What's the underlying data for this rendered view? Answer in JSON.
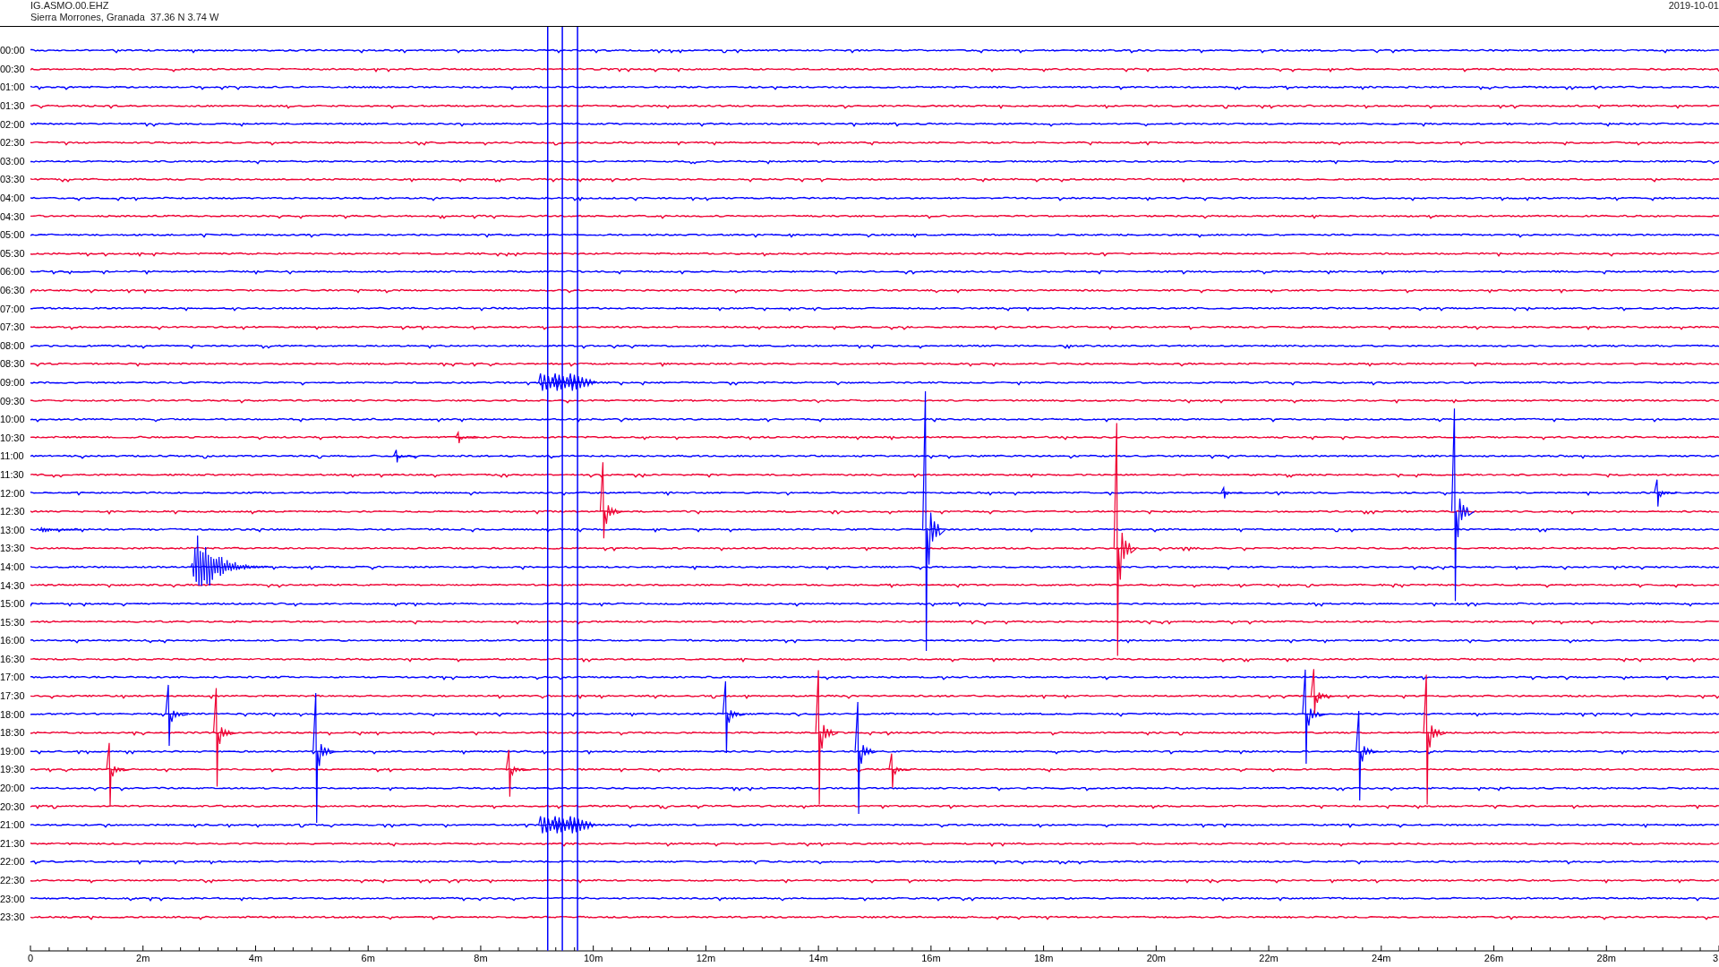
{
  "header": {
    "station": "IG.ASMO.00.EHZ",
    "location": "Sierra Morrones, Granada  37.36 N 3.74 W",
    "date": "2019-10-01"
  },
  "traces": [
    {
      "time": "00:00",
      "color": "#0000ff"
    },
    {
      "time": "00:30",
      "color": "#ee0033"
    },
    {
      "time": "01:00",
      "color": "#0000ff"
    },
    {
      "time": "01:30",
      "color": "#ee0033"
    },
    {
      "time": "02:00",
      "color": "#0000ff"
    },
    {
      "time": "02:30",
      "color": "#ee0033"
    },
    {
      "time": "03:00",
      "color": "#0000ff"
    },
    {
      "time": "03:30",
      "color": "#ee0033"
    },
    {
      "time": "04:00",
      "color": "#0000ff"
    },
    {
      "time": "04:30",
      "color": "#ee0033"
    },
    {
      "time": "05:00",
      "color": "#0000ff"
    },
    {
      "time": "05:30",
      "color": "#ee0033"
    },
    {
      "time": "06:00",
      "color": "#0000ff"
    },
    {
      "time": "06:30",
      "color": "#ee0033"
    },
    {
      "time": "07:00",
      "color": "#0000ff"
    },
    {
      "time": "07:30",
      "color": "#ee0033"
    },
    {
      "time": "08:00",
      "color": "#0000ff"
    },
    {
      "time": "08:30",
      "color": "#ee0033"
    },
    {
      "time": "09:00",
      "color": "#0000ff"
    },
    {
      "time": "09:30",
      "color": "#ee0033"
    },
    {
      "time": "10:00",
      "color": "#0000ff"
    },
    {
      "time": "10:30",
      "color": "#ee0033"
    },
    {
      "time": "11:00",
      "color": "#0000ff"
    },
    {
      "time": "11:30",
      "color": "#ee0033"
    },
    {
      "time": "12:00",
      "color": "#0000ff"
    },
    {
      "time": "12:30",
      "color": "#ee0033"
    },
    {
      "time": "13:00",
      "color": "#0000ff"
    },
    {
      "time": "13:30",
      "color": "#ee0033"
    },
    {
      "time": "14:00",
      "color": "#0000ff"
    },
    {
      "time": "14:30",
      "color": "#ee0033"
    },
    {
      "time": "15:00",
      "color": "#0000ff"
    },
    {
      "time": "15:30",
      "color": "#ee0033"
    },
    {
      "time": "16:00",
      "color": "#0000ff"
    },
    {
      "time": "16:30",
      "color": "#ee0033"
    },
    {
      "time": "17:00",
      "color": "#0000ff"
    },
    {
      "time": "17:30",
      "color": "#ee0033"
    },
    {
      "time": "18:00",
      "color": "#0000ff"
    },
    {
      "time": "18:30",
      "color": "#ee0033"
    },
    {
      "time": "19:00",
      "color": "#0000ff"
    },
    {
      "time": "19:30",
      "color": "#ee0033"
    },
    {
      "time": "20:00",
      "color": "#0000ff"
    },
    {
      "time": "20:30",
      "color": "#ee0033"
    },
    {
      "time": "21:00",
      "color": "#0000ff"
    },
    {
      "time": "21:30",
      "color": "#ee0033"
    },
    {
      "time": "22:00",
      "color": "#0000ff"
    },
    {
      "time": "22:30",
      "color": "#ee0033"
    },
    {
      "time": "23:00",
      "color": "#0000ff"
    },
    {
      "time": "23:30",
      "color": "#ee0033"
    }
  ],
  "x_axis": {
    "ticks": [
      "0",
      "2m",
      "4m",
      "6m",
      "8m",
      "10m",
      "12m",
      "14m",
      "16m",
      "18m",
      "20m",
      "22m",
      "24m",
      "26m",
      "28m",
      "3"
    ]
  }
}
